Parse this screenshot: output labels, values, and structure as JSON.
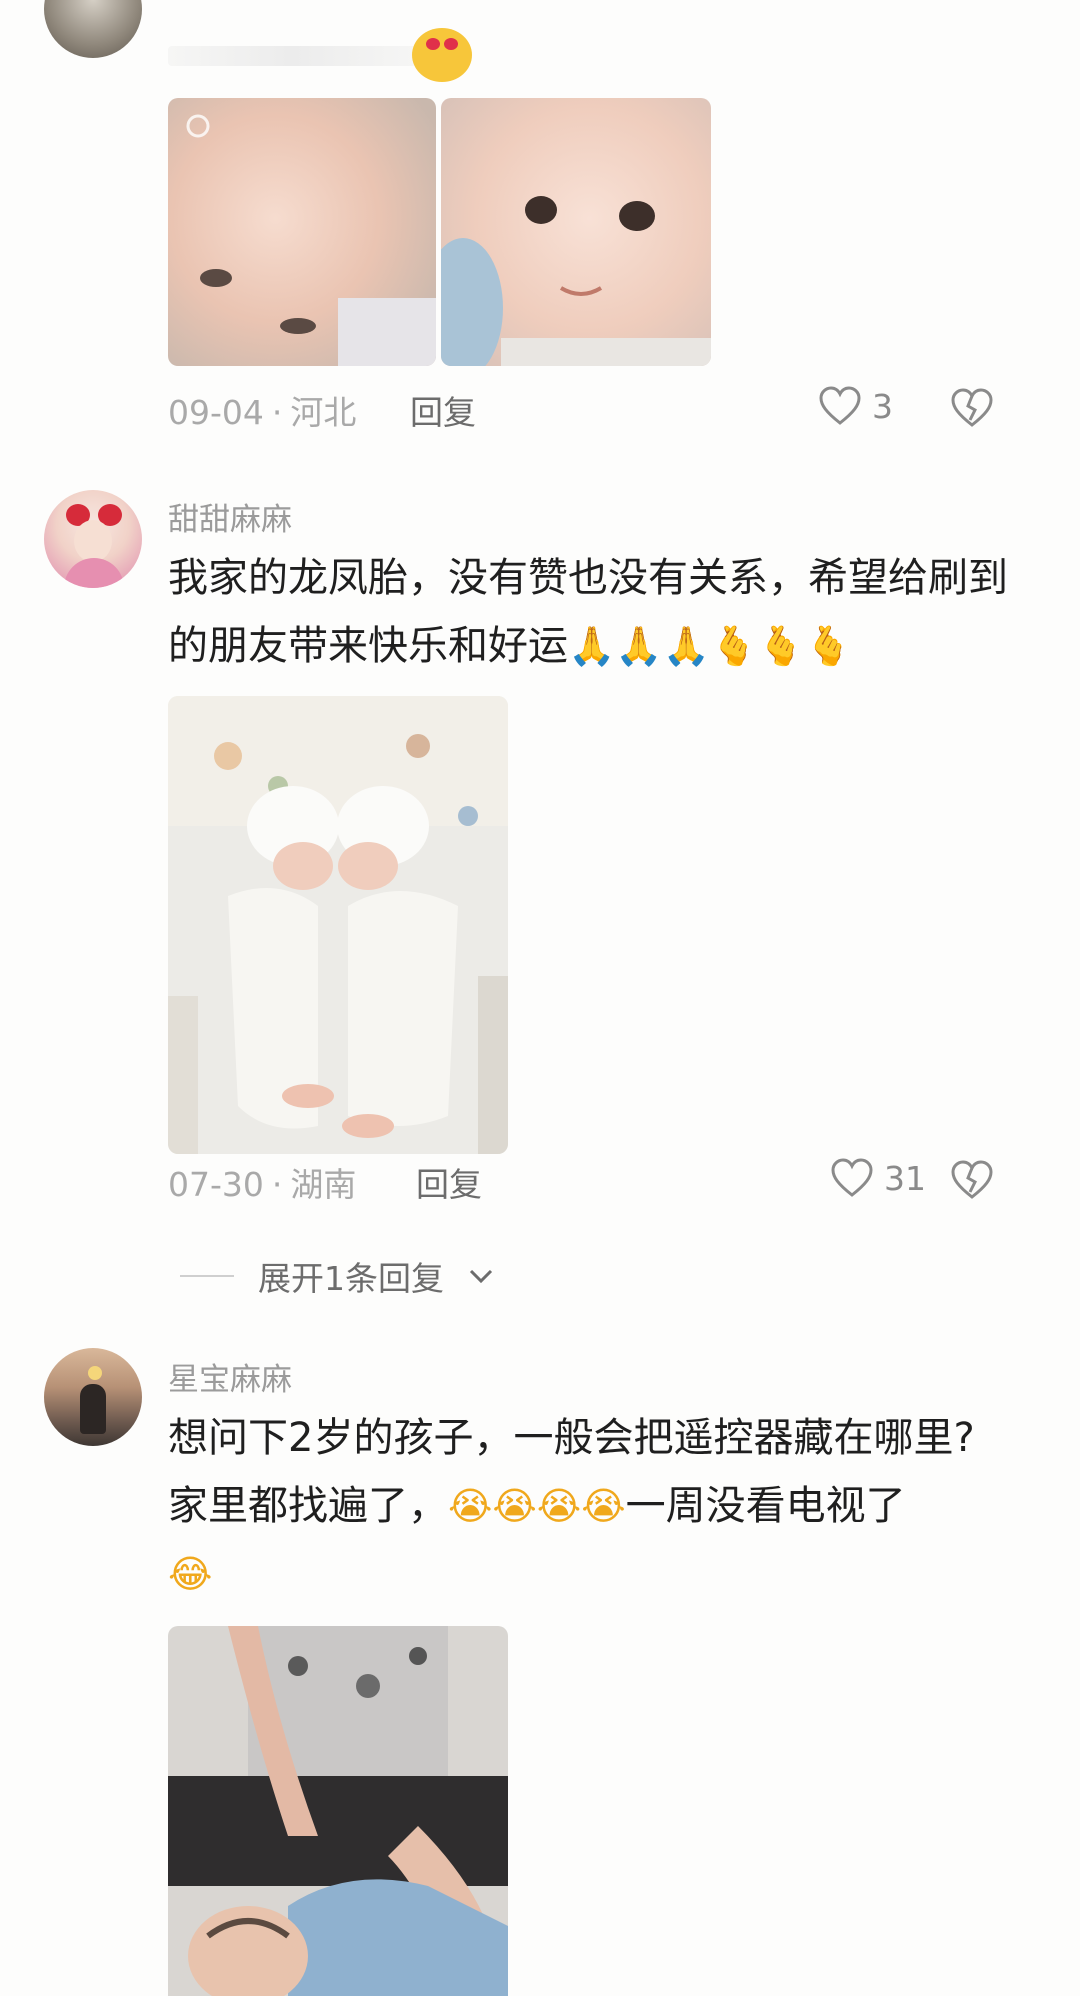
{
  "comment_top": {
    "date": "09-04",
    "location": "河北",
    "reply_label": "回复",
    "like_count": "3",
    "partial_emoji": "😍"
  },
  "comment_1": {
    "username": "甜甜麻麻",
    "text": "我家的龙凤胎，没有赞也没有关系，希望给刷到的朋友带来快乐和好运",
    "emojis": "🙏🙏🙏🫰🫰🫰",
    "date": "07-30",
    "location": "湖南",
    "reply_label": "回复",
    "like_count": "31",
    "expand_label": "展开1条回复"
  },
  "comment_2": {
    "username": "星宝麻麻",
    "text_line1": "想问下2岁的孩子，一般会把遥控器藏在哪里?",
    "text_line2_a": "家里都找遍了，",
    "text_line2_emojis": "😭😭😭😭",
    "text_line2_b": "一周没看电视了",
    "text_line3_emoji": "😂"
  },
  "separator": "·",
  "colors": {
    "background": "#fdfdfc",
    "meta": "#a9a9a9",
    "username": "#9b9b9b",
    "text": "#1f1f1f"
  }
}
